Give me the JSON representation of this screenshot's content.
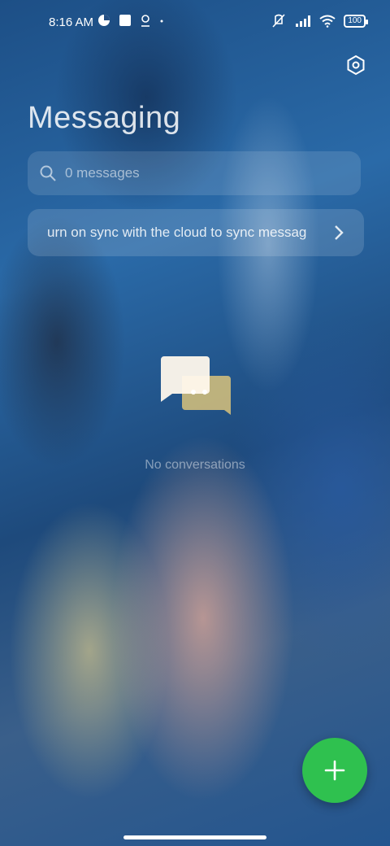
{
  "status_bar": {
    "time": "8:16 AM",
    "battery": "100",
    "left_icons": [
      "data-saver-icon",
      "app-notification-icon",
      "location-icon",
      "dot-icon"
    ],
    "right_icons": [
      "vibrate-off-icon",
      "signal-icon",
      "wifi-icon",
      "battery-icon"
    ]
  },
  "header": {
    "title": "Messaging",
    "settings_icon": "settings-hexagon-icon"
  },
  "search": {
    "placeholder": "0 messages",
    "icon": "search-icon"
  },
  "sync_banner": {
    "text": "urn on sync with the cloud to sync messag",
    "icon": "chevron-right-icon"
  },
  "empty_state": {
    "icon": "chat-bubbles-icon",
    "text": "No conversations"
  },
  "fab": {
    "icon": "plus-icon",
    "color": "#2fc14f"
  },
  "colors": {
    "fab_green": "#2fc14f",
    "bubble_front": "#fff8ec",
    "bubble_back": "#f2d27a"
  }
}
